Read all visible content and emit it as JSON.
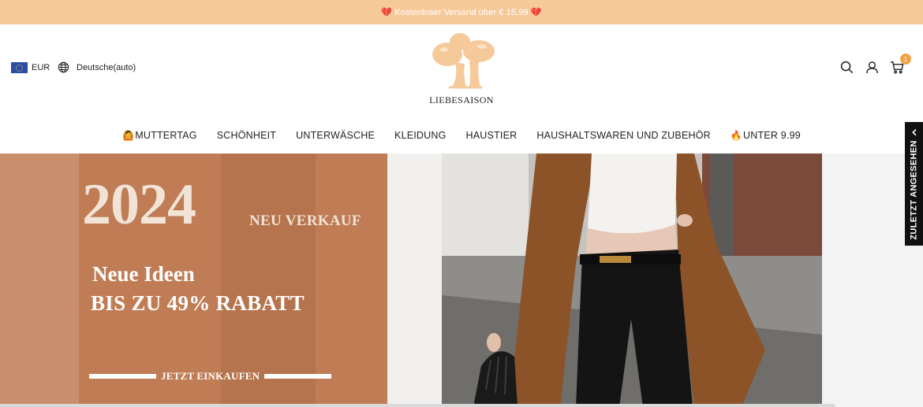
{
  "announcement": {
    "text": "Kostenloser Versand über € 15,99",
    "heart": "💔"
  },
  "header": {
    "currency": "EUR",
    "language": "Deutsche(auto)",
    "logo_text": "LIEBESAISON",
    "cart_count": "1",
    "icons": [
      "search-icon",
      "account-icon",
      "cart-icon",
      "globe-icon",
      "eu-flag-icon"
    ]
  },
  "nav": {
    "items": [
      {
        "emoji": "🙆",
        "label": "MUTTERTAG"
      },
      {
        "emoji": "",
        "label": "SCHÖNHEIT"
      },
      {
        "emoji": "",
        "label": "UNTERWÄSCHE"
      },
      {
        "emoji": "",
        "label": "KLEIDUNG"
      },
      {
        "emoji": "",
        "label": "HAUSTIER"
      },
      {
        "emoji": "",
        "label": "HAUSHALTSWAREN UND ZUBEHÖR"
      },
      {
        "emoji": "🔥",
        "label": "UNTER 9.99"
      }
    ]
  },
  "hero": {
    "year": "2024",
    "sale_label": "NEU VERKAUF",
    "line1": "Neue Ideen",
    "line2": "BIS ZU 49% RABATT",
    "cta": "JETZT EINKAUFEN"
  },
  "recently_viewed": {
    "label": "ZULETZT ANGESEHEN"
  },
  "colors": {
    "announcement_bg": "#f6c99a",
    "hero_panel": "#bf7c55",
    "accent_badge": "#f0a24a",
    "logo_mushroom": "#f6c99a"
  }
}
